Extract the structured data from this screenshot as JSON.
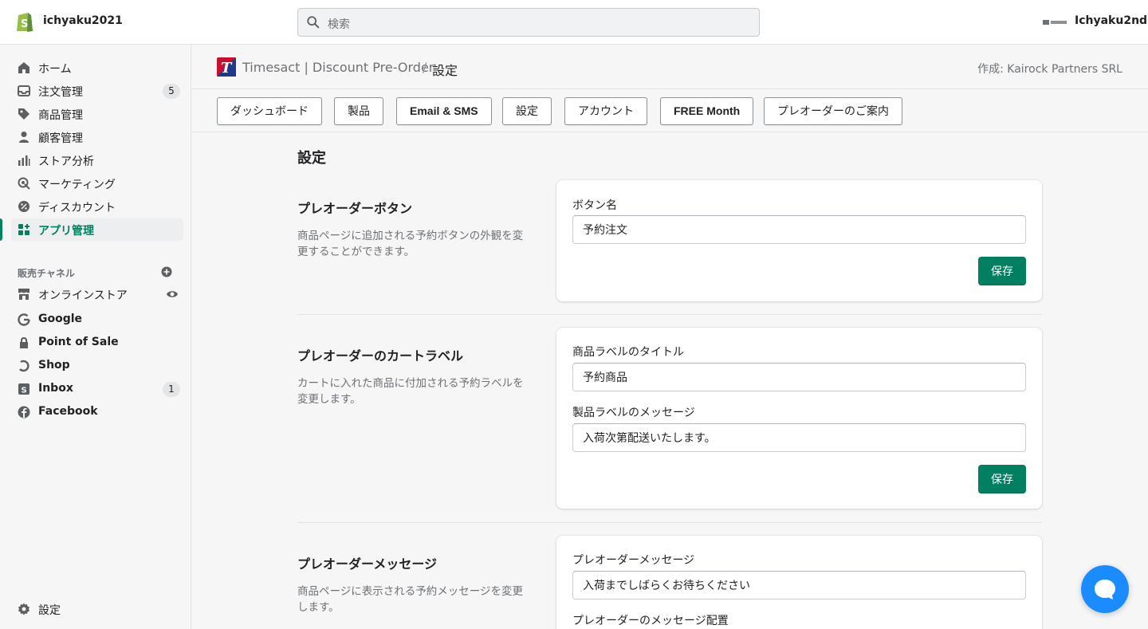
{
  "topbar": {
    "store_name": "ichyaku2021",
    "search_placeholder": "検索",
    "user_name": "Ichyaku2nd"
  },
  "sidebar": {
    "items": [
      {
        "label": "ホーム",
        "icon": "home-icon"
      },
      {
        "label": "注文管理",
        "icon": "orders-icon",
        "badge": "5"
      },
      {
        "label": "商品管理",
        "icon": "tag-icon"
      },
      {
        "label": "顧客管理",
        "icon": "customer-icon"
      },
      {
        "label": "ストア分析",
        "icon": "analytics-icon"
      },
      {
        "label": "マーケティング",
        "icon": "marketing-icon"
      },
      {
        "label": "ディスカウント",
        "icon": "discount-icon"
      },
      {
        "label": "アプリ管理",
        "icon": "apps-icon",
        "active": true
      }
    ],
    "channels_label": "販売チャネル",
    "channels": [
      {
        "label": "オンラインストア",
        "icon": "store-icon"
      },
      {
        "label": "Google",
        "icon": "google-icon"
      },
      {
        "label": "Point of Sale",
        "icon": "pos-icon"
      },
      {
        "label": "Shop",
        "icon": "shop-icon"
      },
      {
        "label": "Inbox",
        "icon": "inbox-icon",
        "badge": "1"
      },
      {
        "label": "Facebook",
        "icon": "facebook-icon"
      }
    ],
    "settings_label": "設定"
  },
  "app_header": {
    "app_name": "Timesact | Discount Pre-Order",
    "separator": "/",
    "current": "設定",
    "author": "作成: Kairock Partners SRL"
  },
  "tabs": [
    "ダッシュボード",
    "製品",
    "Email & SMS",
    "設定",
    "アカウント",
    "FREE Month",
    "プレオーダーのご案内"
  ],
  "page_title": "設定",
  "sections": [
    {
      "title": "プレオーダーボタン",
      "desc": "商品ページに追加される予約ボタンの外観を変更することができます。",
      "fields": [
        {
          "label": "ボタン名",
          "value": "予約注文"
        }
      ],
      "save": "保存"
    },
    {
      "title": "プレオーダーのカートラベル",
      "desc": "カートに入れた商品に付加される予約ラベルを変更します。",
      "fields": [
        {
          "label": "商品ラベルのタイトル",
          "value": "予約商品"
        },
        {
          "label": "製品ラベルのメッセージ",
          "value": "入荷次第配送いたします。"
        }
      ],
      "save": "保存"
    },
    {
      "title": "プレオーダーメッセージ",
      "desc": "商品ページに表示される予約メッセージを変更します。",
      "fields": [
        {
          "label": "プレオーダーメッセージ",
          "value": "入荷までしばらくお待ちください"
        },
        {
          "label": "プレオーダーのメッセージ配置",
          "value": ""
        }
      ]
    }
  ],
  "colors": {
    "accent": "#008060",
    "chat": "#1a8cff"
  }
}
